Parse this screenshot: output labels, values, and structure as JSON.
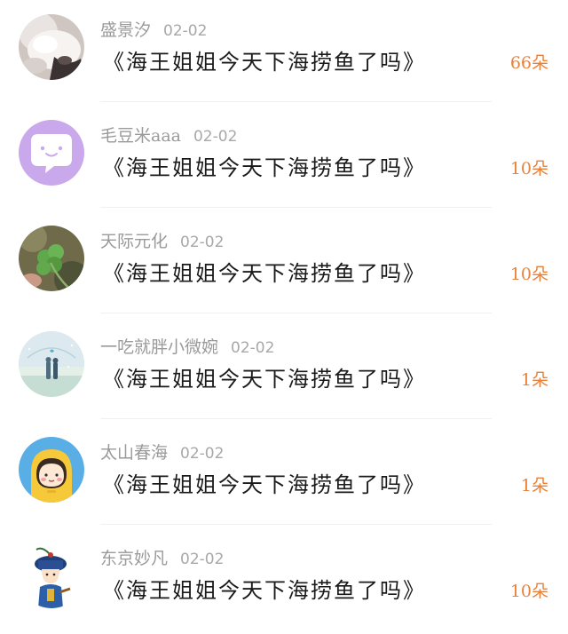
{
  "colors": {
    "name_gray": "#9a9a9a",
    "title_black": "#1a1a1a",
    "flower_orange": "#e8813a",
    "divider": "#f0f0f0"
  },
  "entries": [
    {
      "name": "盛景汐",
      "date": "02-02",
      "title": "《海王姐姐今天下海捞鱼了吗》",
      "flowers": "66朵",
      "avatar_icon": "white-fluffy-animal-avatar"
    },
    {
      "name": "毛豆米aaa",
      "date": "02-02",
      "title": "《海王姐姐今天下海捞鱼了吗》",
      "flowers": "10朵",
      "avatar_icon": "purple-chat-bubble-avatar"
    },
    {
      "name": "天际元化",
      "date": "02-02",
      "title": "《海王姐姐今天下海捞鱼了吗》",
      "flowers": "10朵",
      "avatar_icon": "clover-avatar"
    },
    {
      "name": "一吃就胖小微婉",
      "date": "02-02",
      "title": "《海王姐姐今天下海捞鱼了吗》",
      "flowers": "1朵",
      "avatar_icon": "couple-scene-avatar"
    },
    {
      "name": "太山春海",
      "date": "02-02",
      "title": "《海王姐姐今天下海捞鱼了吗》",
      "flowers": "1朵",
      "avatar_icon": "yellow-raincoat-girl-avatar"
    },
    {
      "name": "东京妙凡",
      "date": "02-02",
      "title": "《海王姐姐今天下海捞鱼了吗》",
      "flowers": "10朵",
      "avatar_icon": "qing-official-cartoon-avatar"
    }
  ]
}
